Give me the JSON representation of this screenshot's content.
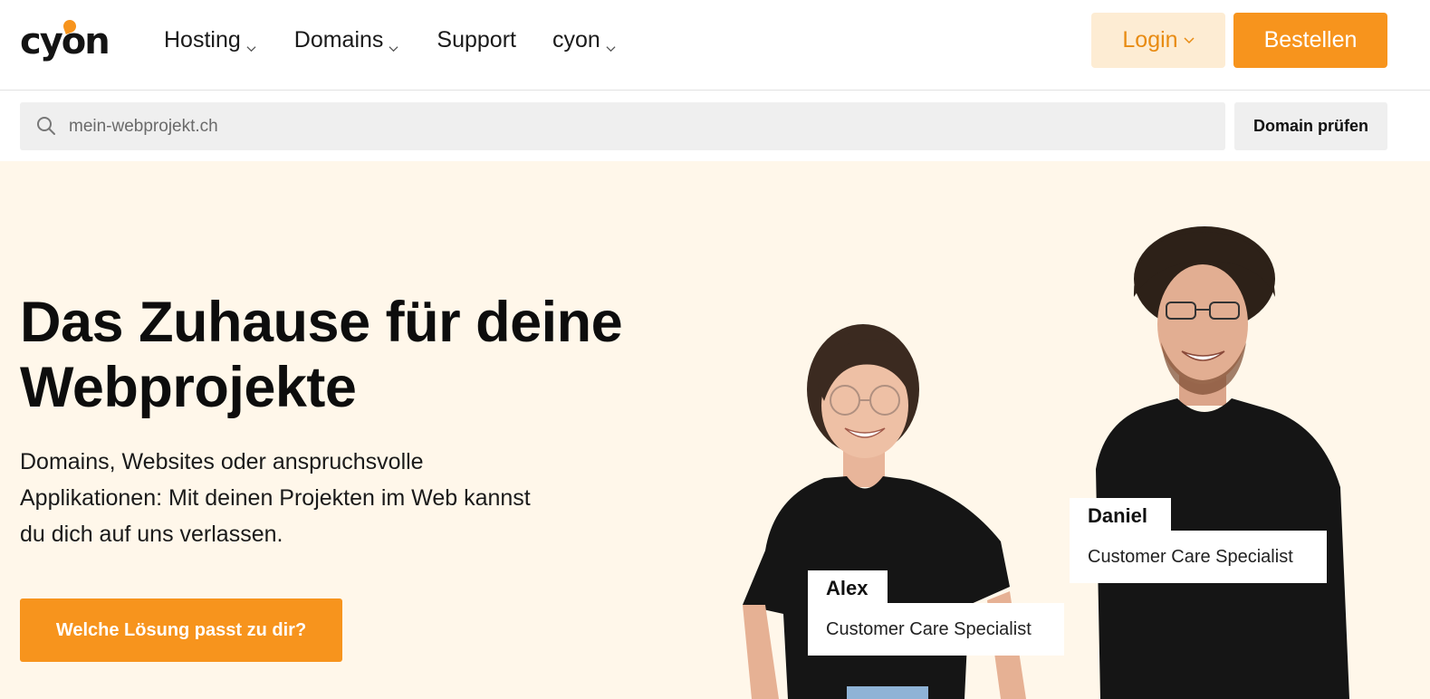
{
  "brand": {
    "logo_text": "cyon",
    "accent_color": "#f7941d",
    "login_bg_color": "#fdecd3",
    "hero_bg_color": "#fff7ea"
  },
  "nav": {
    "items": [
      {
        "label": "Hosting",
        "has_dropdown": true
      },
      {
        "label": "Domains",
        "has_dropdown": true
      },
      {
        "label": "Support",
        "has_dropdown": false
      },
      {
        "label": "cyon",
        "has_dropdown": true
      }
    ],
    "login_label": "Login",
    "order_label": "Bestellen"
  },
  "search": {
    "placeholder": "mein-webprojekt.ch",
    "value": "",
    "button_label": "Domain prüfen",
    "icon": "search-icon"
  },
  "hero": {
    "title_line1": "Das Zuhause für deine",
    "title_line2": "Webprojekte",
    "text_line1": "Domains, Websites oder anspruchsvolle",
    "text_line2": "Applikationen: Mit deinen Projekten im Web kannst",
    "text_line3": "du dich auf uns verlassen.",
    "cta_label": "Welche Lösung passt zu dir?"
  },
  "team": [
    {
      "name": "Alex",
      "role": "Customer Care Specialist"
    },
    {
      "name": "Daniel",
      "role": "Customer Care Specialist"
    }
  ]
}
